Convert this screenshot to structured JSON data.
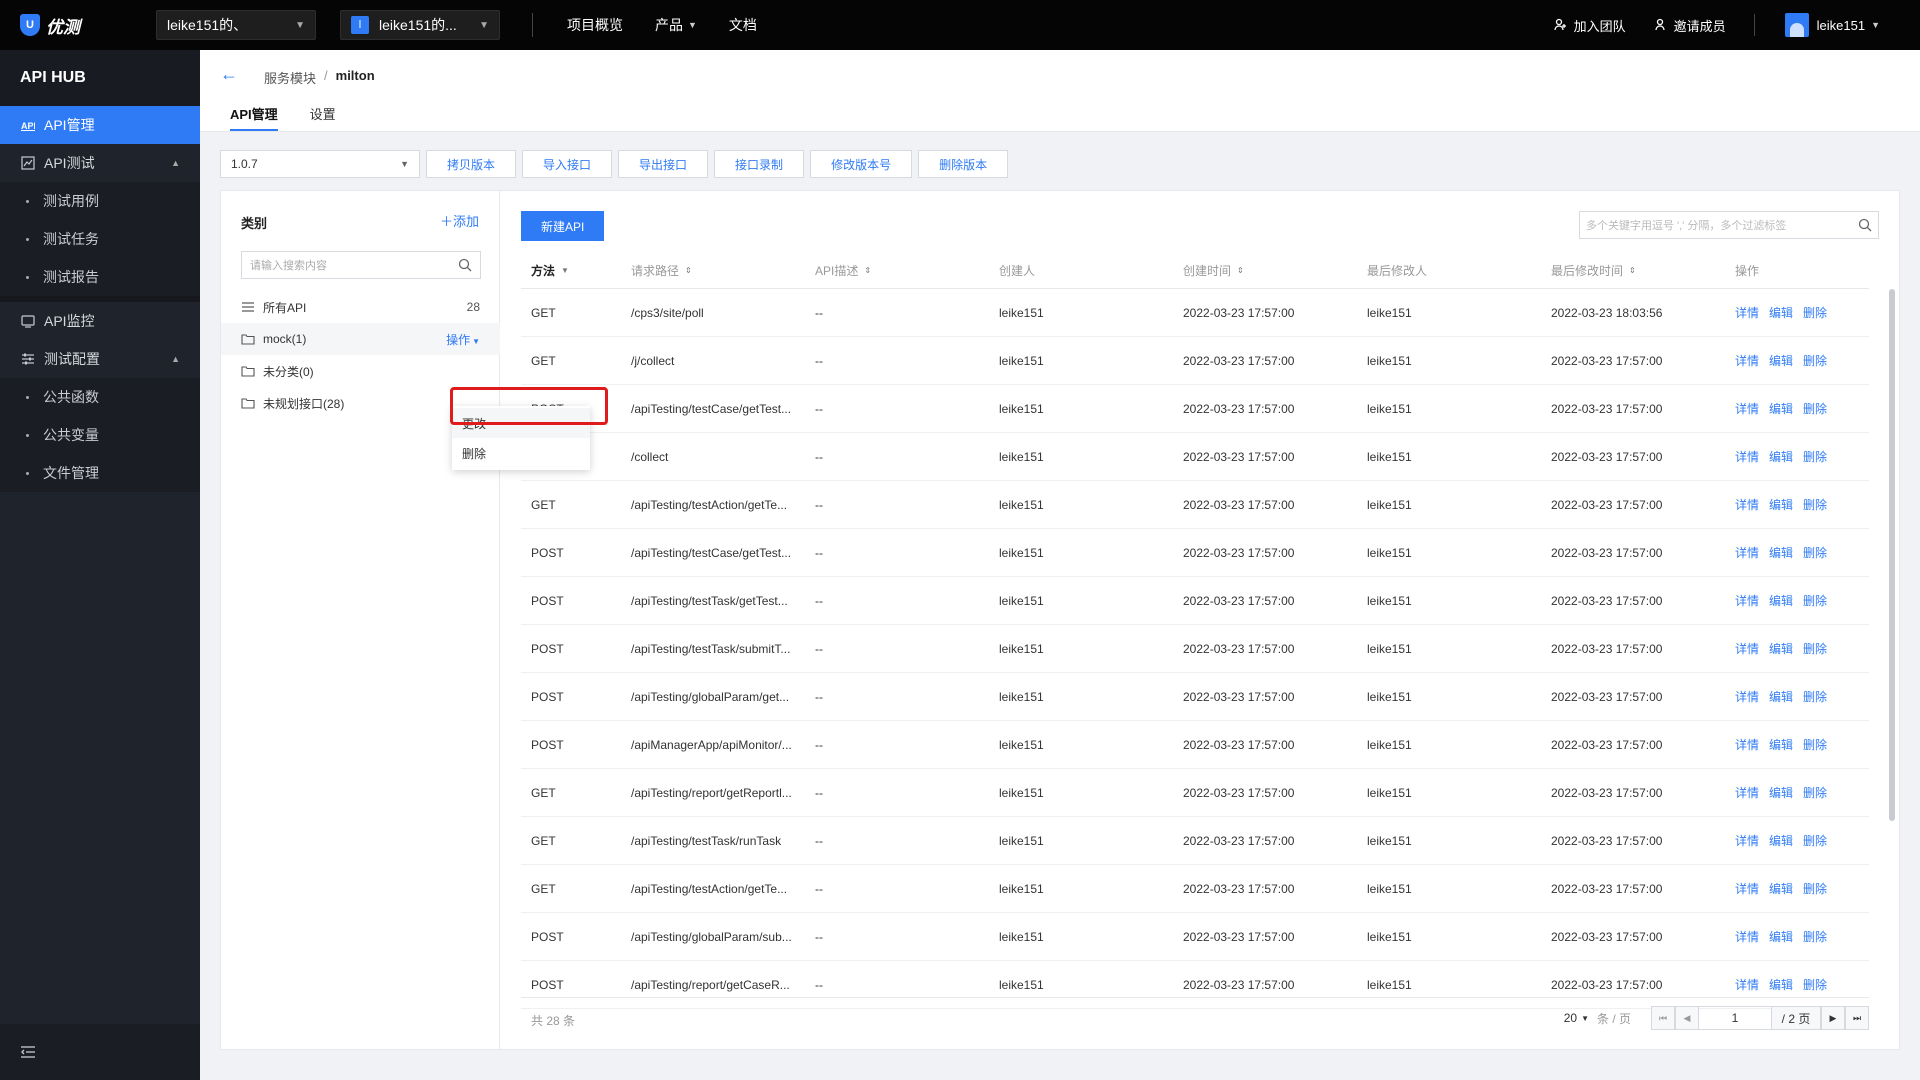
{
  "topbar": {
    "logo_text": "优测",
    "logo_mark": "U",
    "workspace": "leike151的、",
    "project": "leike151的...",
    "project_badge": "l",
    "nav": [
      {
        "label": "项目概览"
      },
      {
        "label": "产品"
      },
      {
        "label": "文档"
      }
    ],
    "join_team": "加入团队",
    "invite": "邀请成员",
    "username": "leike151"
  },
  "sidebar": {
    "title": "API HUB",
    "items": [
      {
        "label": "API管理",
        "icon": "api-icon",
        "active": true
      },
      {
        "label": "API测试",
        "icon": "chart-icon"
      },
      {
        "label": "测试用例"
      },
      {
        "label": "测试任务"
      },
      {
        "label": "测试报告"
      },
      {
        "label": "API监控",
        "icon": "monitor-icon"
      },
      {
        "label": "测试配置",
        "icon": "config-icon"
      },
      {
        "label": "公共函数"
      },
      {
        "label": "公共变量"
      },
      {
        "label": "文件管理"
      }
    ]
  },
  "header": {
    "breadcrumb_parent": "服务模块",
    "breadcrumb_sep": "/",
    "breadcrumb_current": "milton",
    "tabs": [
      {
        "label": "API管理"
      },
      {
        "label": "设置"
      }
    ]
  },
  "version": {
    "selected": "1.0.7",
    "buttons": [
      "拷贝版本",
      "导入接口",
      "导出接口",
      "接口录制",
      "修改版本号",
      "删除版本"
    ]
  },
  "category": {
    "title": "类别",
    "add_label": "添加",
    "search_placeholder": "请输入搜索内容",
    "all_label": "所有API",
    "all_count": "28",
    "groups": [
      {
        "label": "mock(1)"
      },
      {
        "label": "未分类(0)"
      },
      {
        "label": "未规划接口(28)"
      }
    ],
    "op_label": "操作",
    "menu": [
      "更改",
      "删除"
    ]
  },
  "api_table": {
    "new_button": "新建API",
    "search_placeholder": "多个关键字用逗号 ',' 分隔，多个过滤标签",
    "columns": [
      "方法",
      "请求路径",
      "API描述",
      "创建人",
      "创建时间",
      "最后修改人",
      "最后修改时间",
      "操作"
    ],
    "row_actions": [
      "详情",
      "编辑",
      "删除"
    ],
    "rows": [
      {
        "method": "GET",
        "path": "/cps3/site/poll",
        "desc": "--",
        "creator": "leike151",
        "created": "2022-03-23 17:57:00",
        "modifier": "leike151",
        "modified": "2022-03-23 18:03:56"
      },
      {
        "method": "GET",
        "path": "/j/collect",
        "desc": "--",
        "creator": "leike151",
        "created": "2022-03-23 17:57:00",
        "modifier": "leike151",
        "modified": "2022-03-23 17:57:00"
      },
      {
        "method": "POST",
        "path": "/apiTesting/testCase/getTest...",
        "desc": "--",
        "creator": "leike151",
        "created": "2022-03-23 17:57:00",
        "modifier": "leike151",
        "modified": "2022-03-23 17:57:00"
      },
      {
        "method": "GET",
        "path": "/collect",
        "desc": "--",
        "creator": "leike151",
        "created": "2022-03-23 17:57:00",
        "modifier": "leike151",
        "modified": "2022-03-23 17:57:00"
      },
      {
        "method": "GET",
        "path": "/apiTesting/testAction/getTe...",
        "desc": "--",
        "creator": "leike151",
        "created": "2022-03-23 17:57:00",
        "modifier": "leike151",
        "modified": "2022-03-23 17:57:00"
      },
      {
        "method": "POST",
        "path": "/apiTesting/testCase/getTest...",
        "desc": "--",
        "creator": "leike151",
        "created": "2022-03-23 17:57:00",
        "modifier": "leike151",
        "modified": "2022-03-23 17:57:00"
      },
      {
        "method": "POST",
        "path": "/apiTesting/testTask/getTest...",
        "desc": "--",
        "creator": "leike151",
        "created": "2022-03-23 17:57:00",
        "modifier": "leike151",
        "modified": "2022-03-23 17:57:00"
      },
      {
        "method": "POST",
        "path": "/apiTesting/testTask/submitT...",
        "desc": "--",
        "creator": "leike151",
        "created": "2022-03-23 17:57:00",
        "modifier": "leike151",
        "modified": "2022-03-23 17:57:00"
      },
      {
        "method": "POST",
        "path": "/apiTesting/globalParam/get...",
        "desc": "--",
        "creator": "leike151",
        "created": "2022-03-23 17:57:00",
        "modifier": "leike151",
        "modified": "2022-03-23 17:57:00"
      },
      {
        "method": "POST",
        "path": "/apiManagerApp/apiMonitor/...",
        "desc": "--",
        "creator": "leike151",
        "created": "2022-03-23 17:57:00",
        "modifier": "leike151",
        "modified": "2022-03-23 17:57:00"
      },
      {
        "method": "GET",
        "path": "/apiTesting/report/getReportl...",
        "desc": "--",
        "creator": "leike151",
        "created": "2022-03-23 17:57:00",
        "modifier": "leike151",
        "modified": "2022-03-23 17:57:00"
      },
      {
        "method": "GET",
        "path": "/apiTesting/testTask/runTask",
        "desc": "--",
        "creator": "leike151",
        "created": "2022-03-23 17:57:00",
        "modifier": "leike151",
        "modified": "2022-03-23 17:57:00"
      },
      {
        "method": "GET",
        "path": "/apiTesting/testAction/getTe...",
        "desc": "--",
        "creator": "leike151",
        "created": "2022-03-23 17:57:00",
        "modifier": "leike151",
        "modified": "2022-03-23 17:57:00"
      },
      {
        "method": "POST",
        "path": "/apiTesting/globalParam/sub...",
        "desc": "--",
        "creator": "leike151",
        "created": "2022-03-23 17:57:00",
        "modifier": "leike151",
        "modified": "2022-03-23 17:57:00"
      },
      {
        "method": "POST",
        "path": "/apiTesting/report/getCaseR...",
        "desc": "--",
        "creator": "leike151",
        "created": "2022-03-23 17:57:00",
        "modifier": "leike151",
        "modified": "2022-03-23 17:57:00"
      }
    ],
    "total_text": "共 28 条",
    "page_size": "20",
    "page_size_unit": "条 / 页",
    "current_page": "1",
    "total_pages": "/ 2 页"
  },
  "colors": {
    "accent": "#2f7bf5",
    "highlight": "#e01b1b",
    "sidebar_bg": "#1f232c"
  }
}
